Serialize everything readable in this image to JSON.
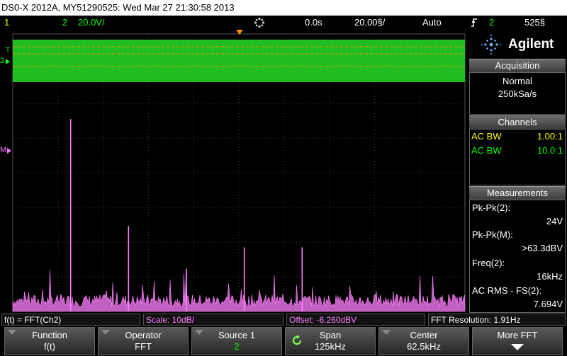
{
  "title": "DS0-X 2012A, MY51290525: Wed Mar 27 21:30:58 2013",
  "status": {
    "ch1_num": "1",
    "ch2_num": "2",
    "ch2_scale": "20.0V/",
    "delay": "0.0s",
    "timebase": "20.00§/",
    "trigger_mode": "Auto",
    "trigger_src": "2",
    "trigger_level": "525§"
  },
  "panel": {
    "brand": "Agilent",
    "acq_title": "Acquisition",
    "acq_mode": "Normal",
    "acq_rate": "250kSa/s",
    "channels_title": "Channels",
    "ch1_coupling": "AC BW",
    "ch1_probe": "1.00:1",
    "ch2_coupling": "AC BW",
    "ch2_probe": "10.0:1",
    "meas_title": "Measurements",
    "m1_label": "Pk-Pk(2):",
    "m1_value": "24V",
    "m2_label": "Pk-Pk(M):",
    "m2_value": ">63.3dBV",
    "m3_label": "Freq(2):",
    "m3_value": "16kHz",
    "m4_label": "AC RMS - FS(2):",
    "m4_value": "7.694V"
  },
  "info": {
    "math": "f(t) = FFT(Ch2)",
    "scale": "Scale: 10dB/",
    "offset": "Offset: -6.260dBV",
    "resolution": "FFT Resolution: 1.91Hz"
  },
  "softkeys": [
    {
      "label": "Function",
      "value": "f(t)"
    },
    {
      "label": "Operator",
      "value": "FFT"
    },
    {
      "label": "Source 1",
      "value": "2"
    },
    {
      "label": "Span",
      "value": "125kHz"
    },
    {
      "label": "Center",
      "value": "62.5kHz"
    },
    {
      "label": "More FFT",
      "value": ""
    }
  ],
  "markers": {
    "ch2": "2",
    "math": "M",
    "trig": "T"
  },
  "colors": {
    "ch1": "#ffff00",
    "ch2": "#00ff00",
    "math": "#ff80ff",
    "grid": "#555555",
    "trig_marker": "#ff8c00"
  },
  "fft_peaks": [
    {
      "freq_khz": 16,
      "level": 0.9
    },
    {
      "freq_khz": 32,
      "level": 0.4
    },
    {
      "freq_khz": 48,
      "level": 0.2
    },
    {
      "freq_khz": 64,
      "level": 0.3
    },
    {
      "freq_khz": 80,
      "level": 0.3
    }
  ]
}
